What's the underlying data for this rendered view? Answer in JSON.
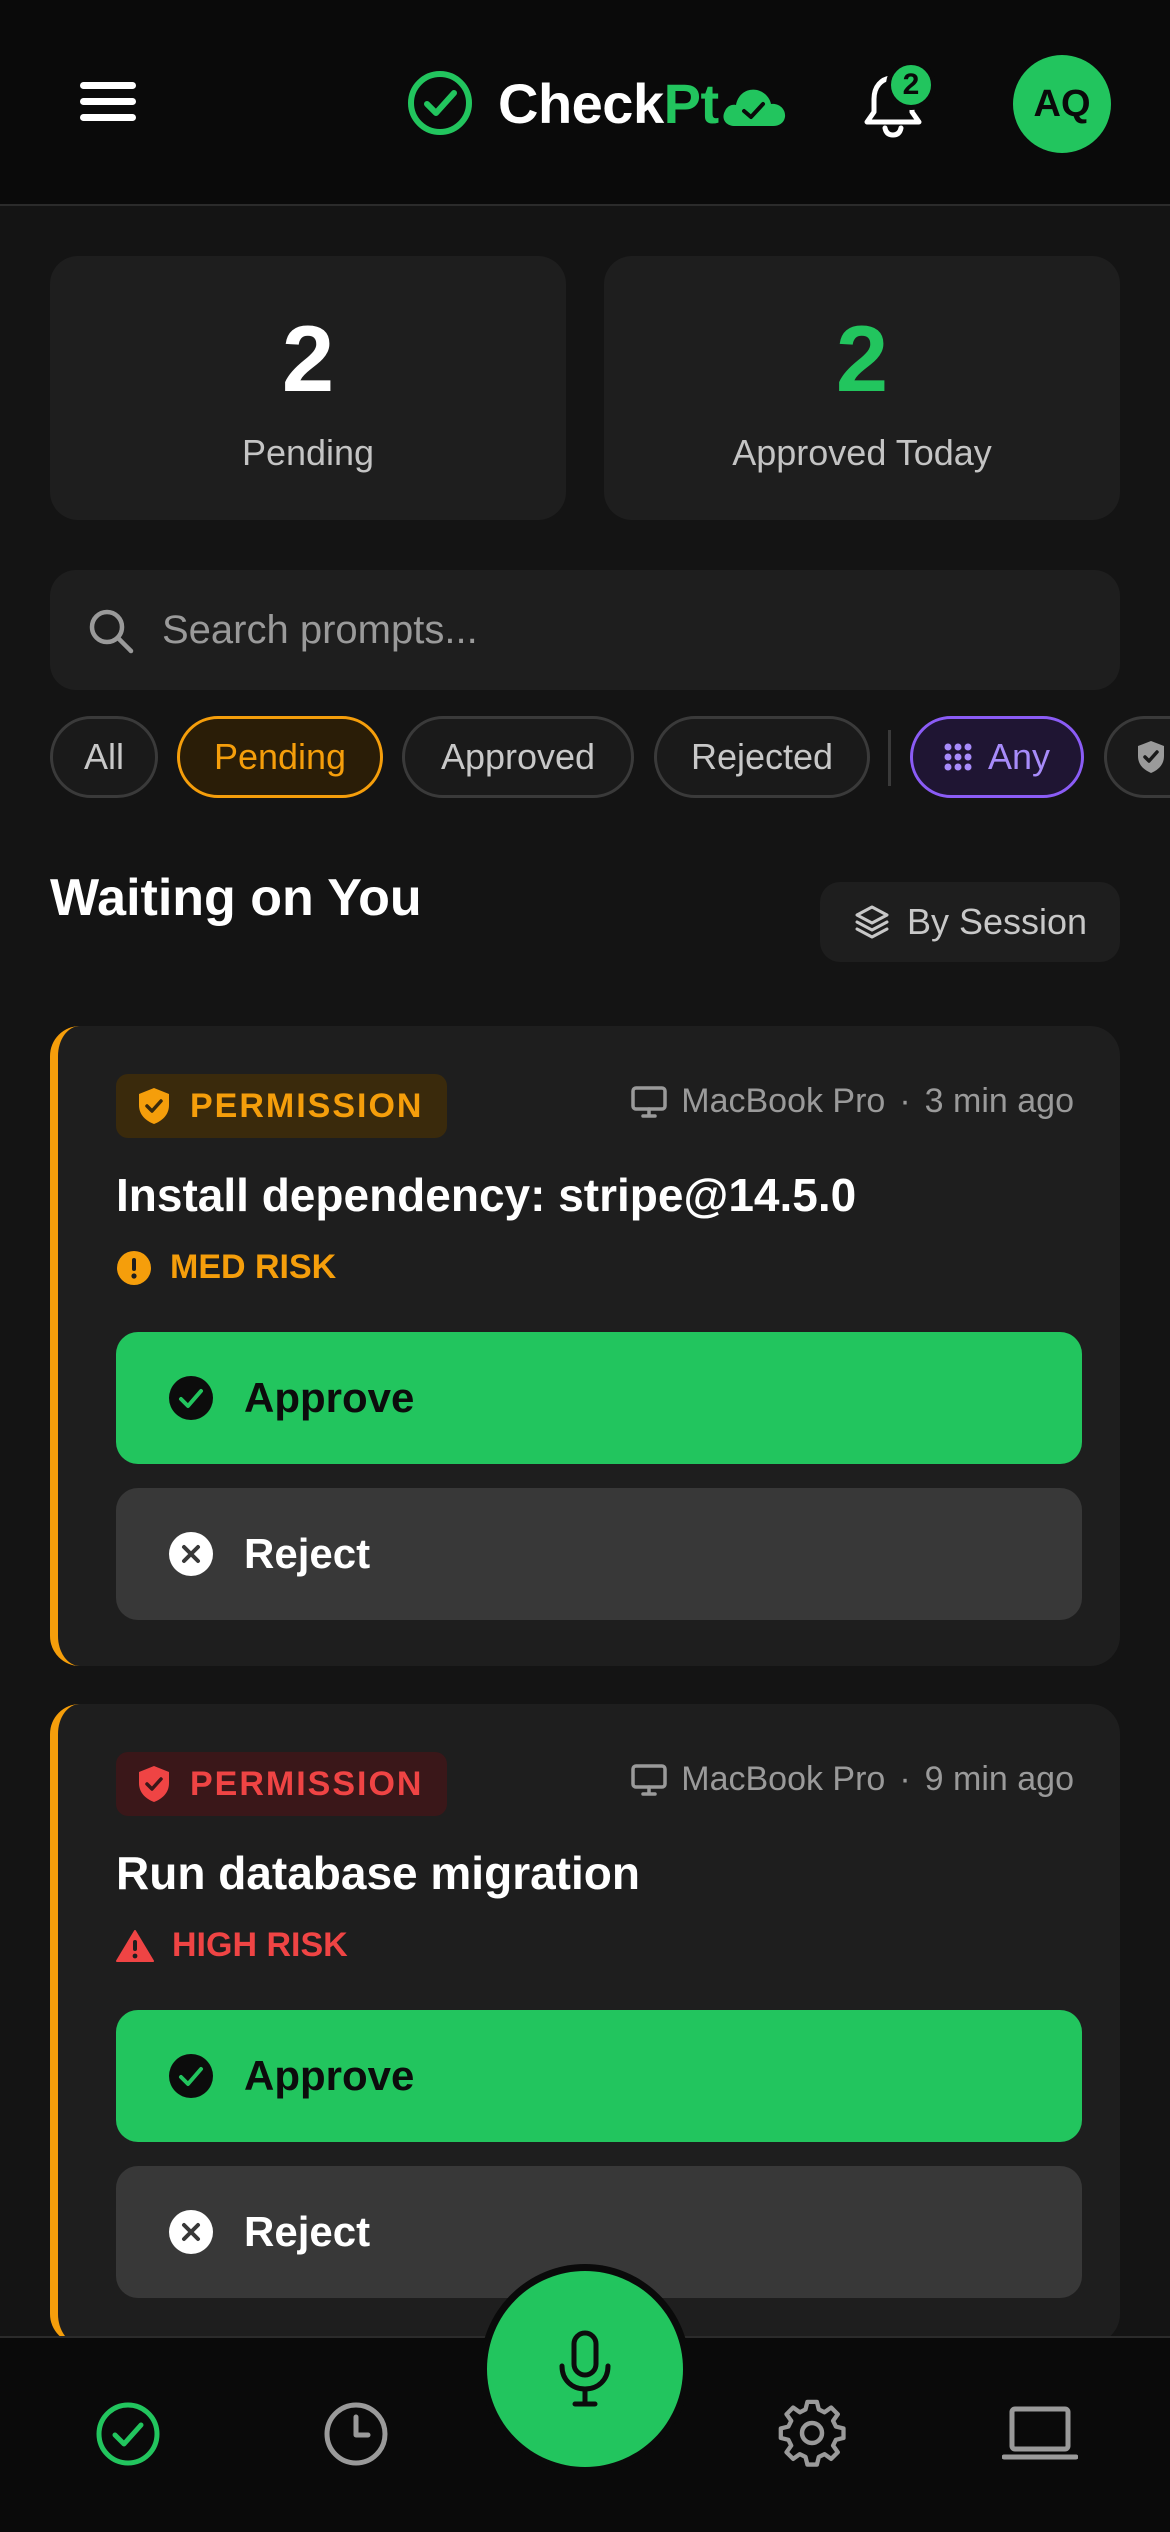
{
  "app": {
    "logo_prefix": "Check",
    "logo_suffix": "Pt",
    "notification_count": "2",
    "avatar_initials": "AQ"
  },
  "stats": {
    "pending_count": "2",
    "pending_label": "Pending",
    "approved_count": "2",
    "approved_label": "Approved Today"
  },
  "search": {
    "placeholder": "Search prompts..."
  },
  "filters": {
    "all": "All",
    "pending": "Pending",
    "approved": "Approved",
    "rejected": "Rejected",
    "any": "Any",
    "active": "Pending"
  },
  "section": {
    "title": "Waiting on You",
    "group_button": "By Session"
  },
  "cards": [
    {
      "tag": "PERMISSION",
      "device": "MacBook Pro",
      "separator": "·",
      "time": "3 min ago",
      "title": "Install dependency: stripe@14.5.0",
      "risk": "MED RISK",
      "approve_label": "Approve",
      "reject_label": "Reject"
    },
    {
      "tag": "PERMISSION",
      "device": "MacBook Pro",
      "separator": "·",
      "time": "9 min ago",
      "title": "Run database migration",
      "risk": "HIGH RISK",
      "approve_label": "Approve",
      "reject_label": "Reject"
    }
  ],
  "colors": {
    "accent": "#22c55e",
    "warning": "#f59e0b",
    "danger": "#ef4444",
    "filter_any": "#8b5cf6",
    "background": "#141414",
    "card": "#1e1e1e"
  },
  "icons": {
    "menu": "hamburger-icon",
    "logo": "check-circle-icon",
    "cloud": "cloud-check-icon",
    "bell": "bell-icon",
    "search": "search-icon",
    "grid": "grid-icon",
    "shield": "shield-icon",
    "layers": "layers-icon",
    "device": "monitor-icon",
    "med_risk": "alert-circle-icon",
    "high_risk": "warning-triangle-icon",
    "approve": "check-circle-icon",
    "reject": "x-circle-icon",
    "nav": [
      "check-circle-icon",
      "clock-icon",
      "microphone-icon",
      "gear-icon",
      "laptop-icon"
    ]
  }
}
